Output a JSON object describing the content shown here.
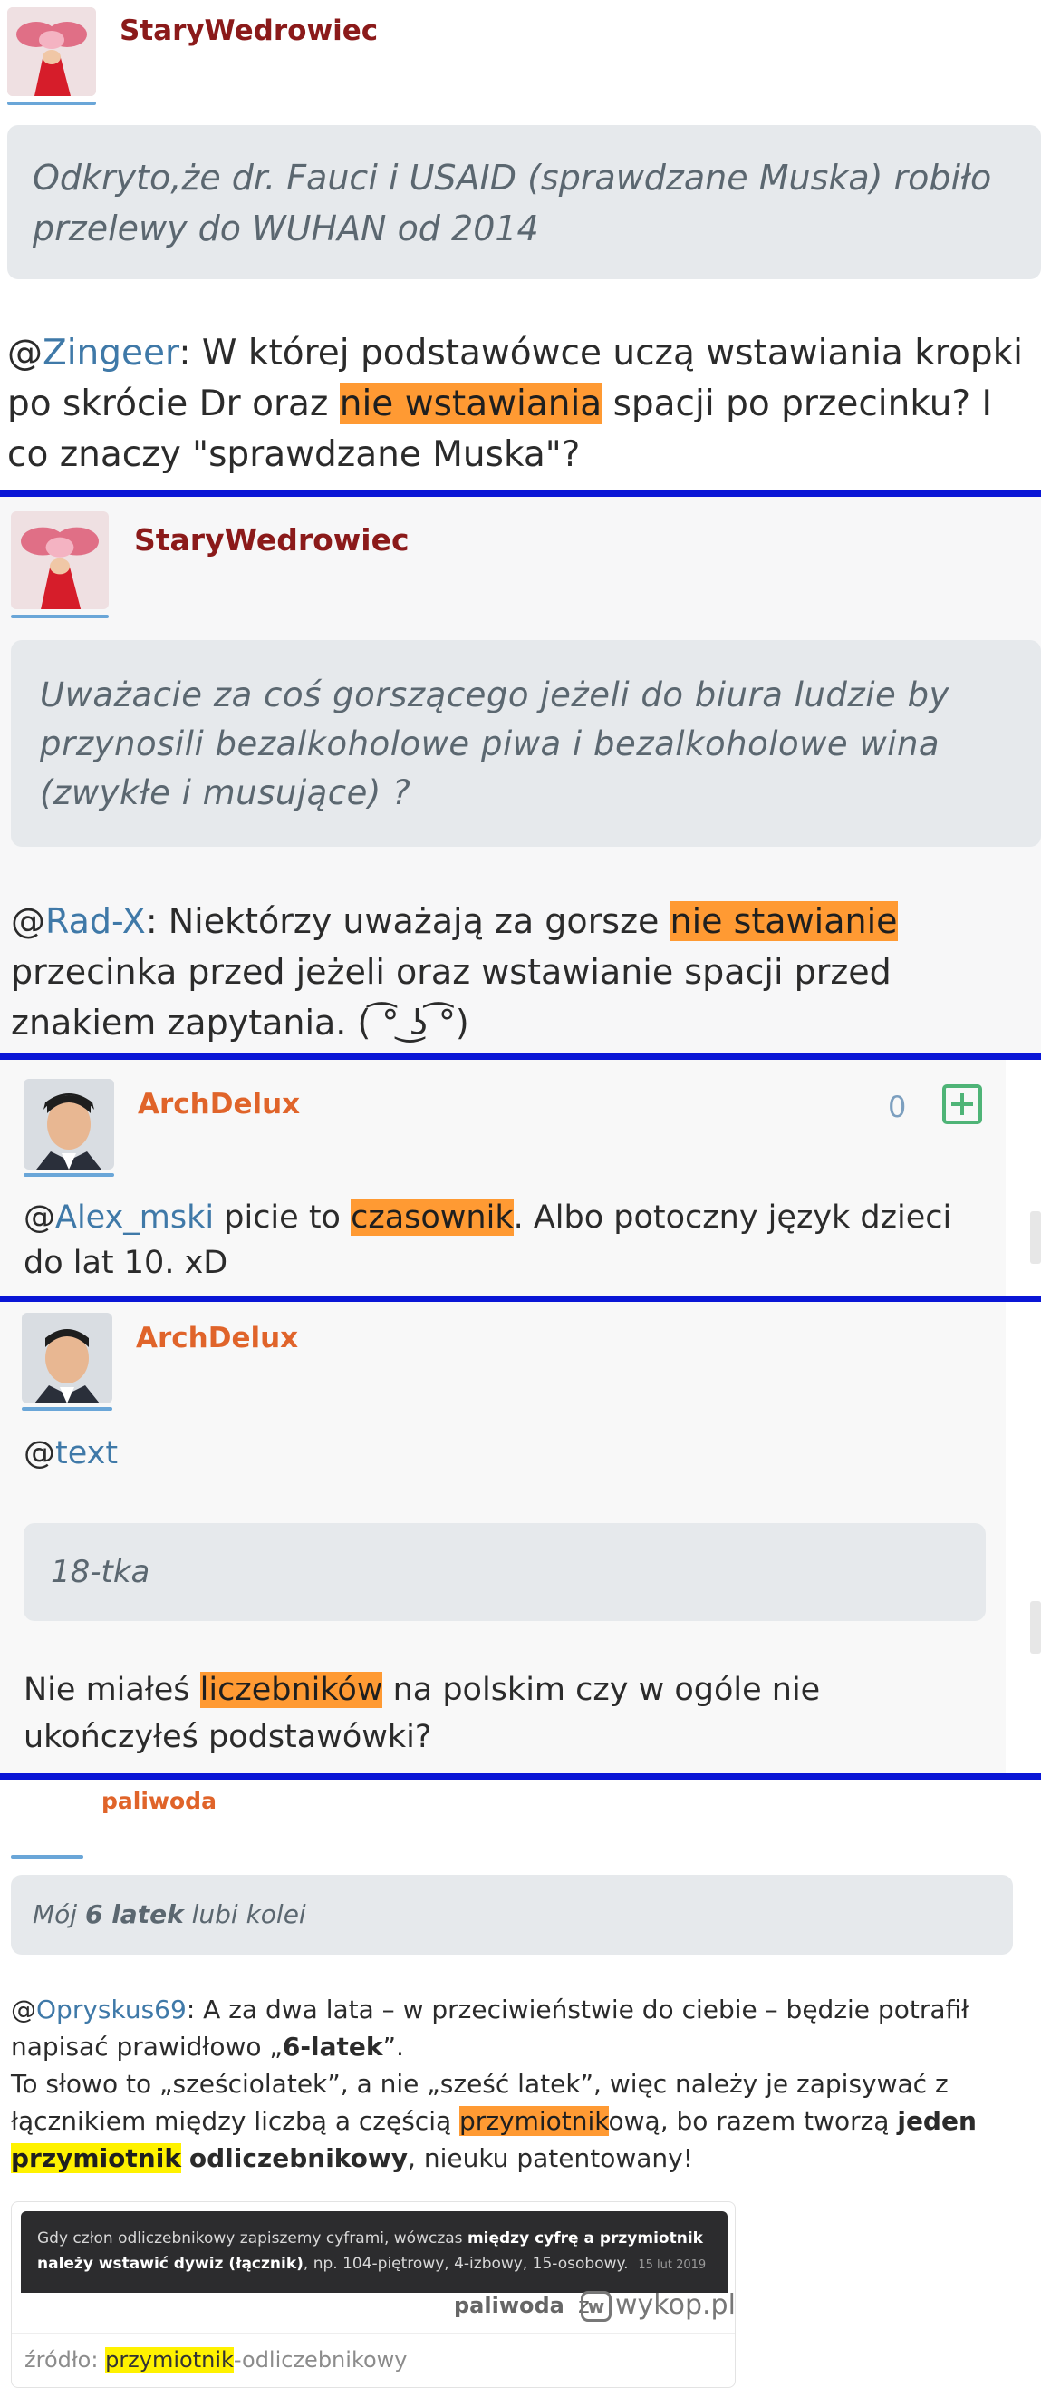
{
  "posts": [
    {
      "author": "StaryWedrowiec",
      "quote": "Odkryto,że dr. Fauci i USAID (sprawdzane Muska) robiło przelewy do WUHAN od 2014",
      "mention": "Zingeer",
      "text_before": ": W której podstawówce uczą wstawiania kropki po skrócie Dr oraz ",
      "highlight": "nie wstawiania",
      "text_after": " spacji po przecinku? I co znaczy \"sprawdzane Muska\"?"
    },
    {
      "author": "StaryWedrowiec",
      "quote": "Uważacie za coś gorszącego jeżeli do biura ludzie by przynosili bezalkoholowe piwa i bezalkoholowe wina (zwykłe i musujące) ?",
      "mention": "Rad-X",
      "text_before": ": Niektórzy uważają za gorsze ",
      "highlight": "nie stawianie",
      "text_after": " przecinka przed jeżeli oraz wstawianie spacji przed znakiem zapytania. ( ͡° ͜ʖ ͡°)"
    },
    {
      "author": "ArchDelux",
      "vote_count": "0",
      "mention": "Alex_mski",
      "text_before": " picie to ",
      "highlight": "czasownik",
      "text_after": ". Albo potoczny język dzieci do lat 10. xD"
    },
    {
      "author": "ArchDelux",
      "mention": "text",
      "quote": "18-tka",
      "text_before": "Nie miałeś ",
      "highlight": "liczebników",
      "text_after": " na polskim czy w ogóle nie ukończyłeś podstawówki?"
    },
    {
      "author": "paliwoda",
      "quote_pre": "Mój ",
      "quote_bold": "6 latek",
      "quote_post": " lubi kolei",
      "mention": "Opryskus69",
      "line1": ": A za dwa lata – w przeciwieństwie do ciebie – będzie potrafił napisać prawidłowo „",
      "line1_bold": "6-latek",
      "line1_end": "”.",
      "line2_a": "To słowo to „sześciolatek”, a nie „sześć latek”, więc należy je zapisywać z łącznikiem między liczbą a częścią ",
      "line2_hl": "przymiotnik",
      "line2_b": "ową, bo razem tworzą ",
      "line2_bold": "jeden",
      "line2_hl2": "przymiotnik",
      "line2_bold2": "odliczebnikowy",
      "line2_end": ", nieuku patentowany!",
      "embed_text_a": "Gdy człon odliczebnikowy zapiszemy cyframi, wówczas ",
      "embed_text_bold": "między cyfrę a przymiotnik należy wstawić dywiz (łącznik)",
      "embed_text_b": ", np. 104-piętrowy, 4-izbowy, 15-osobowy.",
      "embed_date": "15 lut 2019",
      "embed_user": "paliwoda",
      "embed_z": "z",
      "embed_brand": "wykop.pl",
      "source_label": "źródło: ",
      "source_hl": "przymiotnik",
      "source_rest": "-odliczebnikowy"
    }
  ],
  "colors": {
    "separator": "#0a16d6",
    "author_dark": "#8b1a1a",
    "author_orange": "#e0642a",
    "mention": "#3f79a8",
    "highlight_orange": "#ff9a33",
    "highlight_yellow": "#fff200"
  }
}
